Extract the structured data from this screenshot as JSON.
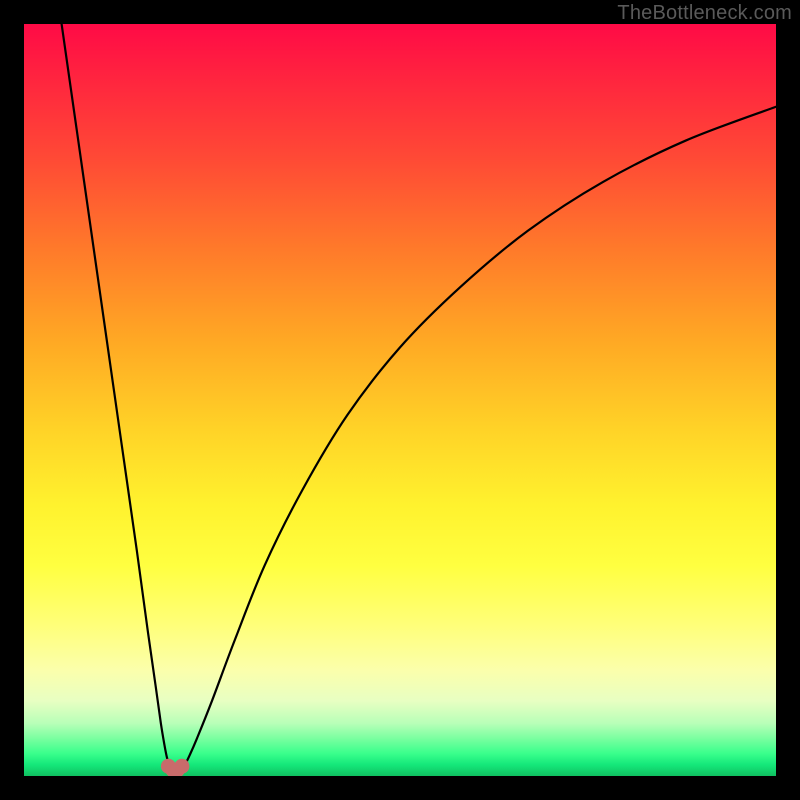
{
  "watermark": "TheBottleneck.com",
  "colors": {
    "frame": "#000000",
    "curve": "#000000",
    "marker": "#c96b6b",
    "watermark": "#5a5a5a"
  },
  "chart_data": {
    "type": "line",
    "title": "",
    "xlabel": "",
    "ylabel": "",
    "xlim": [
      0,
      100
    ],
    "ylim": [
      0,
      100
    ],
    "grid": false,
    "legend": false,
    "series": [
      {
        "name": "left-branch",
        "x": [
          5,
          7,
          9,
          11,
          13,
          15,
          16.5,
          17.5,
          18.2,
          18.7,
          19.0,
          19.3,
          19.6
        ],
        "y": [
          100,
          86,
          72,
          58,
          44,
          30,
          19,
          12,
          7,
          4,
          2.5,
          1.5,
          1.0
        ]
      },
      {
        "name": "right-branch",
        "x": [
          21.0,
          21.4,
          22.0,
          23.0,
          25.0,
          28.0,
          32.0,
          37.0,
          43.0,
          50.0,
          58.0,
          67.0,
          77.0,
          88.0,
          100.0
        ],
        "y": [
          1.0,
          1.5,
          2.7,
          5.0,
          10.0,
          18.0,
          28.0,
          38.0,
          48.0,
          57.0,
          65.0,
          72.5,
          79.0,
          84.5,
          89.0
        ]
      }
    ],
    "markers": {
      "name": "minimum-cluster",
      "x": [
        19.2,
        19.8,
        20.4,
        21.0
      ],
      "y": [
        1.3,
        0.8,
        0.8,
        1.3
      ],
      "color": "#c96b6b"
    },
    "background_gradient": [
      {
        "stop": 0.0,
        "color": "#ff0a46"
      },
      {
        "stop": 0.5,
        "color": "#ffd327"
      },
      {
        "stop": 0.8,
        "color": "#ffff7a"
      },
      {
        "stop": 1.0,
        "color": "#10c060"
      }
    ]
  }
}
